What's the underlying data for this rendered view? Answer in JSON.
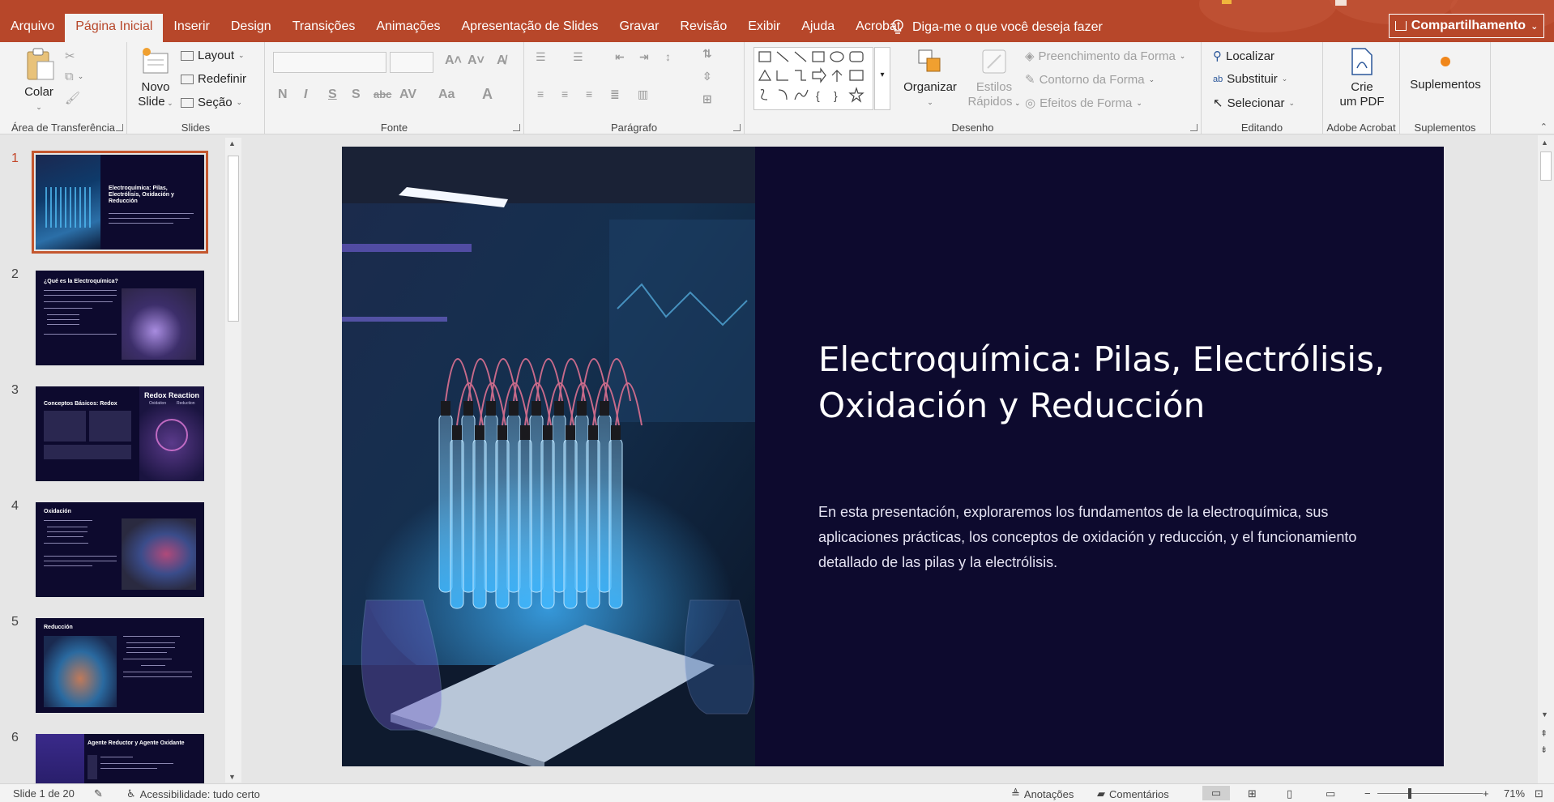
{
  "tabs": [
    {
      "label": "Arquivo",
      "active": false
    },
    {
      "label": "Página Inicial",
      "active": true
    },
    {
      "label": "Inserir",
      "active": false
    },
    {
      "label": "Design",
      "active": false
    },
    {
      "label": "Transições",
      "active": false
    },
    {
      "label": "Animações",
      "active": false
    },
    {
      "label": "Apresentação de Slides",
      "active": false
    },
    {
      "label": "Gravar",
      "active": false
    },
    {
      "label": "Revisão",
      "active": false
    },
    {
      "label": "Exibir",
      "active": false
    },
    {
      "label": "Ajuda",
      "active": false
    },
    {
      "label": "Acrobat",
      "active": false
    }
  ],
  "tellme": "Diga-me o que você deseja fazer",
  "share_label": "Compartilhamento",
  "ribbon": {
    "clipboard": {
      "paste": "Colar",
      "group": "Área de Transferência"
    },
    "slides": {
      "new_slide_1": "Novo",
      "new_slide_2": "Slide",
      "layout": "Layout",
      "reset": "Redefinir",
      "section": "Seção",
      "group": "Slides"
    },
    "font": {
      "bold": "N",
      "italic": "I",
      "underline": "S",
      "shadow": "S",
      "strike": "abc",
      "spacing": "AV",
      "case": "Aa",
      "color": "A",
      "group": "Fonte"
    },
    "paragraph": {
      "group": "Parágrafo"
    },
    "drawing": {
      "arrange": "Organizar",
      "quick_styles_1": "Estilos",
      "quick_styles_2": "Rápidos",
      "fill": "Preenchimento da Forma",
      "outline": "Contorno da Forma",
      "effects": "Efeitos de Forma",
      "group": "Desenho"
    },
    "editing": {
      "find": "Localizar",
      "replace": "Substituir",
      "select": "Selecionar",
      "group": "Editando"
    },
    "acrobat": {
      "create_pdf_1": "Crie",
      "create_pdf_2": "um PDF",
      "group": "Adobe Acrobat"
    },
    "addins": {
      "label": "Suplementos",
      "group": "Suplementos"
    }
  },
  "thumbnails": [
    {
      "num": "1",
      "title": "Electroquímica: Pilas, Electrólisis, Oxidación y Reducción"
    },
    {
      "num": "2",
      "title": "¿Qué es la Electroquímica?"
    },
    {
      "num": "3",
      "title": "Conceptos Básicos: Redox",
      "image_text": "Redox Reaction",
      "image_sub_1": "Oxidation",
      "image_sub_2": "Reduction"
    },
    {
      "num": "4",
      "title": "Oxidación"
    },
    {
      "num": "5",
      "title": "Reducción"
    },
    {
      "num": "6",
      "title": "Agente Reductor y Agente Oxidante"
    }
  ],
  "slide": {
    "title": "Electroquímica: Pilas, Electrólisis, Oxidación y Reducción",
    "body": "En esta presentación, exploraremos los fundamentos de la electroquímica, sus aplicaciones prácticas, los conceptos de oxidación y reducción, y el funcionamiento detallado de las pilas y la electrólisis."
  },
  "status": {
    "slide_count": "Slide 1 de 20",
    "accessibility": "Acessibilidade: tudo certo",
    "notes": "Anotações",
    "comments": "Comentários",
    "zoom": "71%"
  },
  "colors": {
    "accent": "#b7472a",
    "slide_bg": "#0d0a2e"
  }
}
